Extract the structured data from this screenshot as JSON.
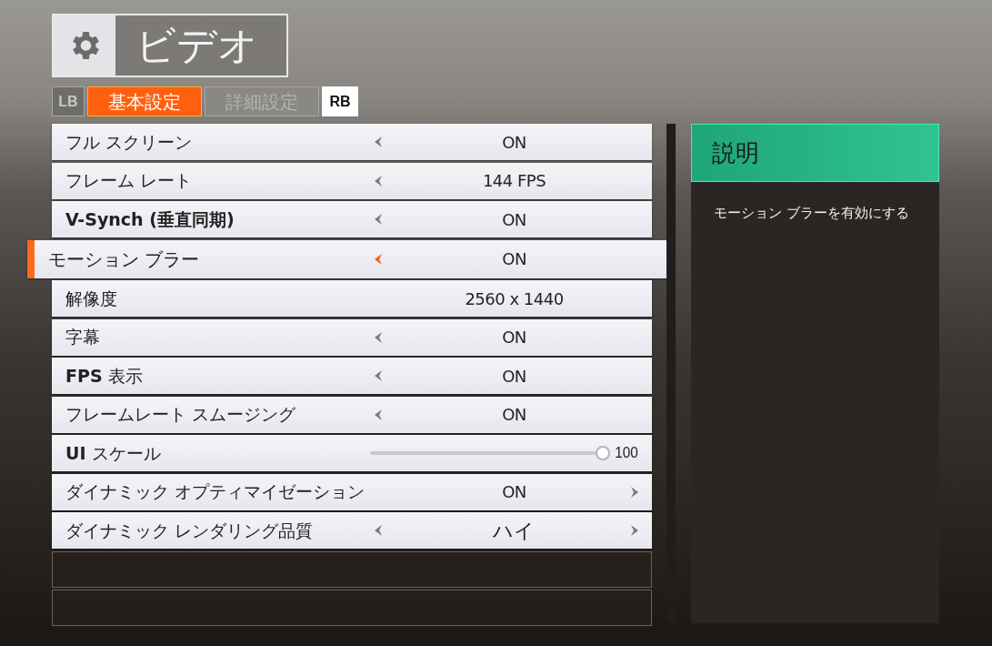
{
  "header": {
    "title": "ビデオ"
  },
  "bumpers": [
    {
      "label": "LB",
      "disabled": true
    },
    {
      "label": "RB",
      "disabled": false
    }
  ],
  "tabs": [
    {
      "label": "基本設定",
      "selected": true
    },
    {
      "label": "詳細設定",
      "selected": false
    }
  ],
  "settings": [
    {
      "kind": "choice",
      "label": "フル スクリーン",
      "value": "ON",
      "left_arrow": true,
      "right_arrow": false,
      "selected": false
    },
    {
      "kind": "choice",
      "label": "フレーム レート",
      "value": "144 FPS",
      "left_arrow": true,
      "right_arrow": false,
      "selected": false
    },
    {
      "kind": "choice",
      "label": "V-Synch (垂直同期)",
      "bold": true,
      "value": "ON",
      "left_arrow": true,
      "right_arrow": false,
      "selected": false
    },
    {
      "kind": "choice",
      "label": "モーション ブラー",
      "value": "ON",
      "left_arrow": true,
      "right_arrow": false,
      "selected": true
    },
    {
      "kind": "choice",
      "label": "解像度",
      "value": "2560 x 1440",
      "left_arrow": false,
      "right_arrow": false,
      "selected": false
    },
    {
      "kind": "choice",
      "label": "字幕",
      "value": "ON",
      "left_arrow": true,
      "right_arrow": false,
      "selected": false
    },
    {
      "kind": "choice",
      "label": "**FPS** 表示",
      "value": "ON",
      "left_arrow": true,
      "right_arrow": false,
      "selected": false
    },
    {
      "kind": "choice",
      "label": "フレームレート スムージング",
      "value": "ON",
      "left_arrow": true,
      "right_arrow": false,
      "selected": false
    },
    {
      "kind": "slider",
      "label": "**UI** スケール",
      "value": "100",
      "level": 1,
      "selected": false
    },
    {
      "kind": "choice",
      "label": "ダイナミック オプティマイゼーション",
      "value": "ON",
      "left_arrow": false,
      "right_arrow": true,
      "selected": false
    },
    {
      "kind": "choice",
      "label": "ダイナミック レンダリング品質",
      "value": "ハイ",
      "large": true,
      "left_arrow": true,
      "right_arrow": true,
      "selected": false
    }
  ],
  "description": {
    "title": "説明",
    "text": "モーション ブラーを有効にする"
  }
}
